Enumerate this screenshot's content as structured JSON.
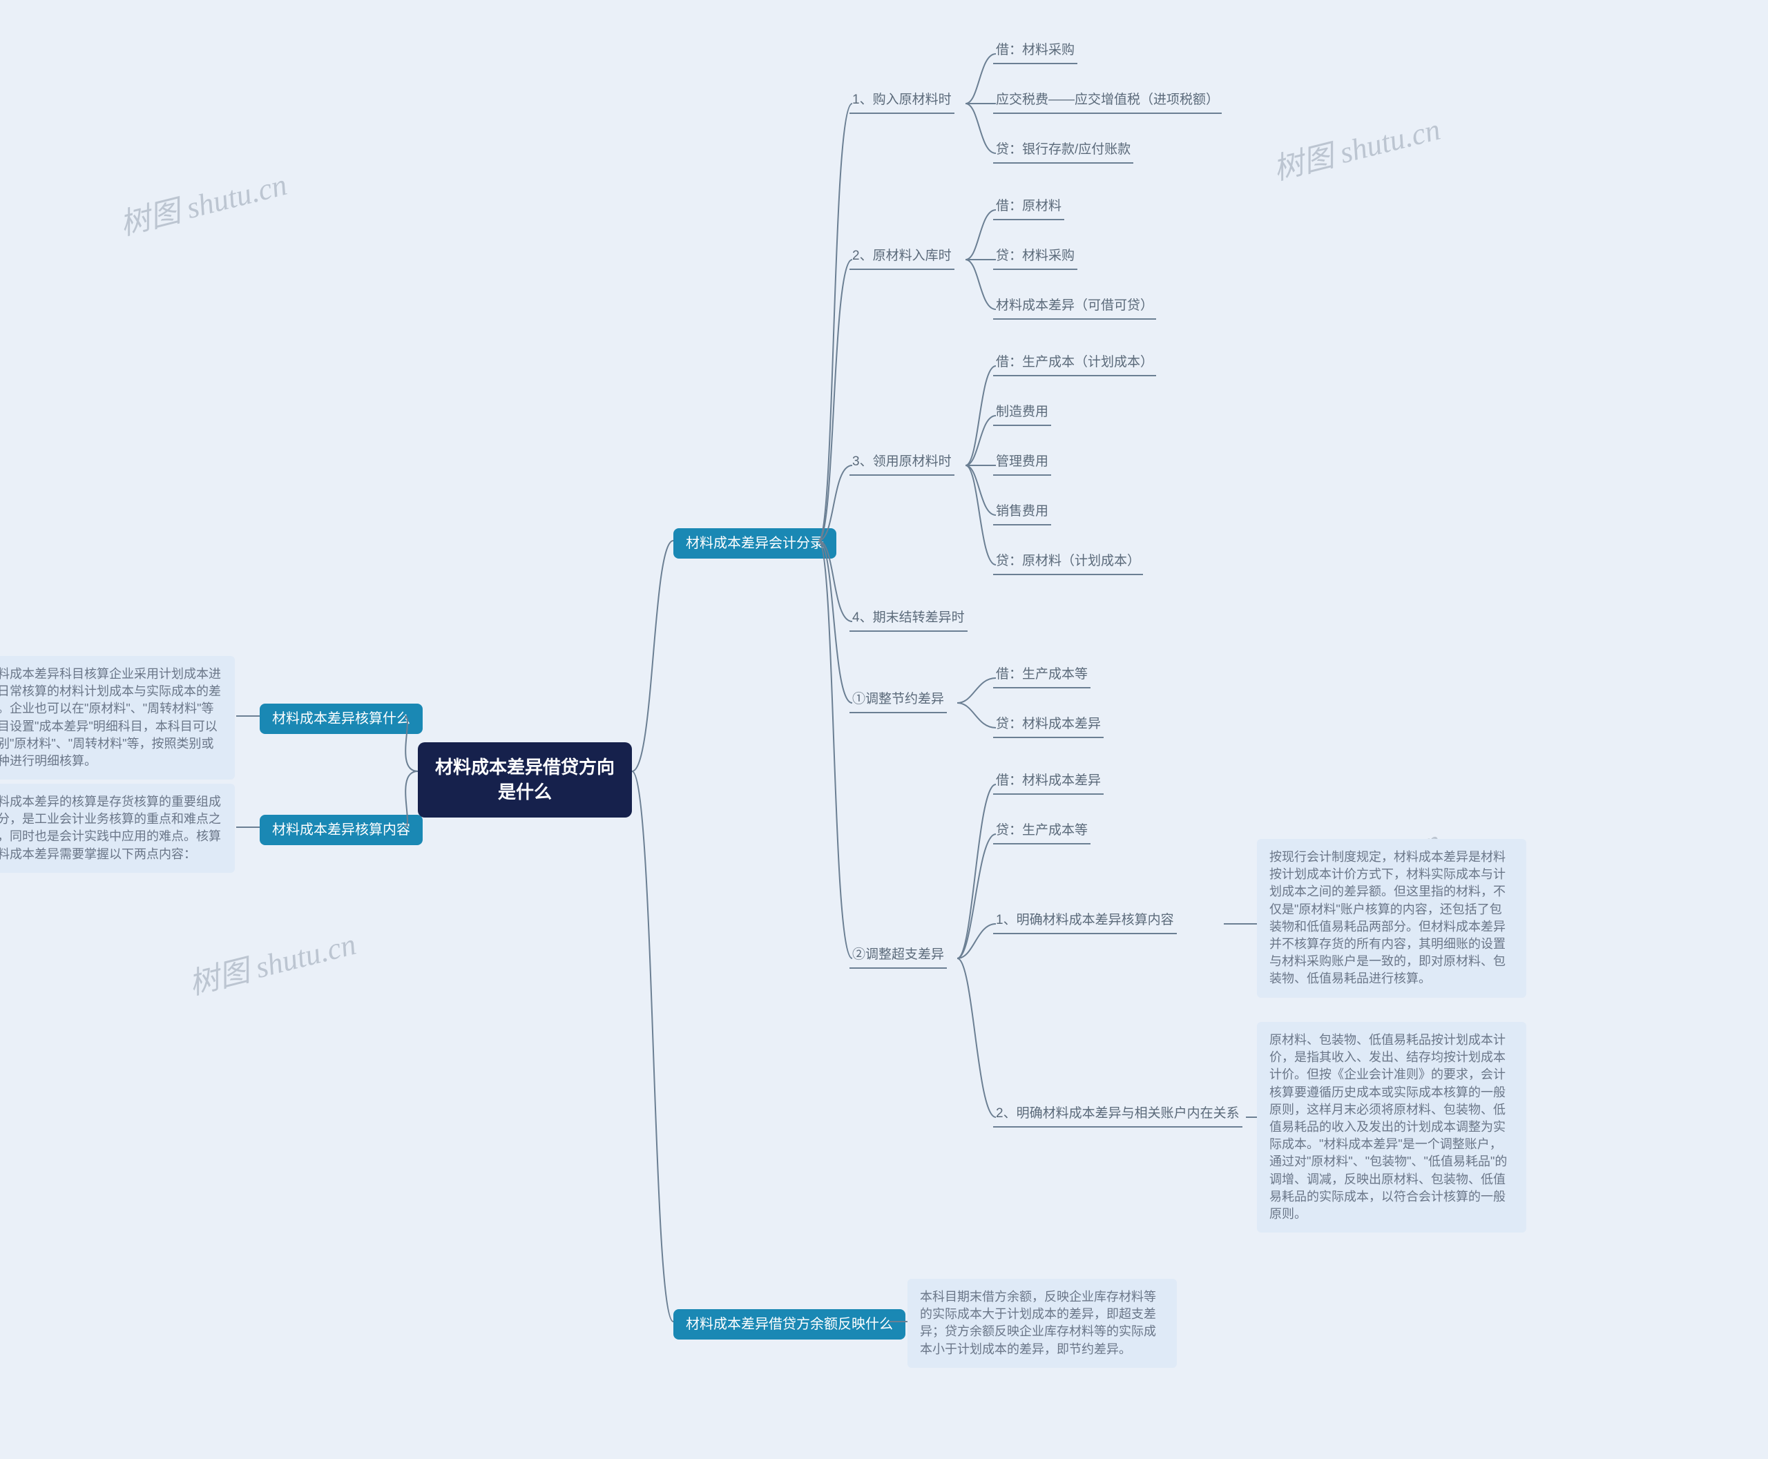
{
  "watermark": "树图 shutu.cn",
  "root": {
    "title": "材料成本差异借贷方向是什么"
  },
  "left": {
    "cat1": {
      "label": "材料成本差异核算什么",
      "desc": "材料成本差异科目核算企业采用计划成本进行日常核算的材料计划成本与实际成本的差额。企业也可以在\"原材料\"、\"周转材料\"等科目设置\"成本差异\"明细科目，本科目可以分别\"原材料\"、\"周转材料\"等，按照类别或品种进行明细核算。"
    },
    "cat2": {
      "label": "材料成本差异核算内容",
      "desc": "材料成本差异的核算是存货核算的重要组成部分，是工业会计业务核算的重点和难点之一，同时也是会计实践中应用的难点。核算材料成本差异需要掌握以下两点内容："
    }
  },
  "right": {
    "cat1": {
      "label": "材料成本差异会计分录",
      "s1": {
        "label": "1、购入原材料时",
        "a": "借：材料采购",
        "b": "应交税费——应交增值税（进项税额）",
        "c": "贷：银行存款/应付账款"
      },
      "s2": {
        "label": "2、原材料入库时",
        "a": "借：原材料",
        "b": "贷：材料采购",
        "c": "材料成本差异（可借可贷）"
      },
      "s3": {
        "label": "3、领用原材料时",
        "a": "借：生产成本（计划成本）",
        "b": "制造费用",
        "c": "管理费用",
        "d": "销售费用",
        "e": "贷：原材料（计划成本）"
      },
      "s4": {
        "label": "4、期末结转差异时"
      },
      "s5": {
        "label": "①调整节约差异",
        "a": "借：生产成本等",
        "b": "贷：材料成本差异"
      },
      "s6": {
        "label": "②调整超支差异",
        "a": "借：材料成本差异",
        "b": "贷：生产成本等",
        "c": {
          "label": "1、明确材料成本差异核算内容",
          "desc": "按现行会计制度规定，材料成本差异是材料按计划成本计价方式下，材料实际成本与计划成本之间的差异额。但这里指的材料，不仅是\"原材料\"账户核算的内容，还包括了包装物和低值易耗品两部分。但材料成本差异并不核算存货的所有内容，其明细账的设置与材料采购账户是一致的，即对原材料、包装物、低值易耗品进行核算。"
        },
        "d": {
          "label": "2、明确材料成本差异与相关账户内在关系",
          "desc": "原材料、包装物、低值易耗品按计划成本计价，是指其收入、发出、结存均按计划成本计价。但按《企业会计准则》的要求，会计核算要遵循历史成本或实际成本核算的一般原则，这样月末必须将原材料、包装物、低值易耗品的收入及发出的计划成本调整为实际成本。\"材料成本差异\"是一个调整账户，通过对\"原材料\"、\"包装物\"、\"低值易耗品\"的调增、调减，反映出原材料、包装物、低值易耗品的实际成本，以符合会计核算的一般原则。"
        }
      }
    },
    "cat2": {
      "label": "材料成本差异借贷方余额反映什么",
      "desc": "本科目期末借方余额，反映企业库存材料等的实际成本大于计划成本的差异，即超支差异；贷方余额反映企业库存材料等的实际成本小于计划成本的差异，即节约差异。"
    }
  }
}
